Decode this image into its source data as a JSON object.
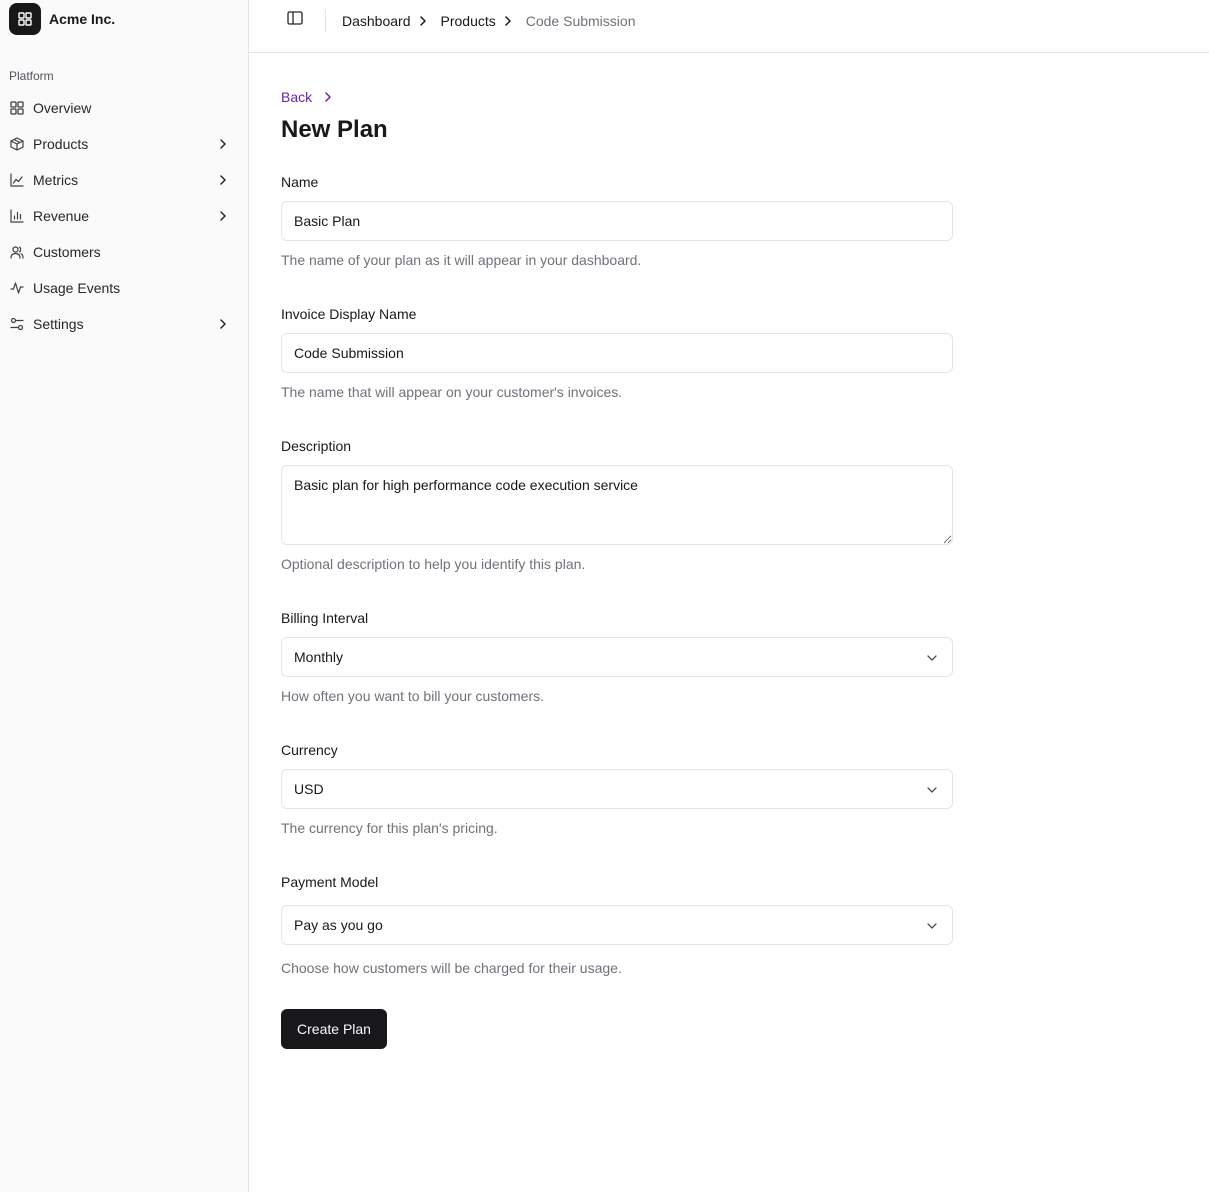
{
  "sidebar": {
    "brand": {
      "name": "Acme Inc.",
      "icon": "grid-icon"
    },
    "group_label": "Platform",
    "items": [
      {
        "label": "Overview",
        "icon": "layout-grid-icon",
        "has_submenu": false
      },
      {
        "label": "Products",
        "icon": "package-icon",
        "has_submenu": true
      },
      {
        "label": "Metrics",
        "icon": "line-chart-icon",
        "has_submenu": true
      },
      {
        "label": "Revenue",
        "icon": "bar-chart-icon",
        "has_submenu": true
      },
      {
        "label": "Customers",
        "icon": "users-icon",
        "has_submenu": false
      },
      {
        "label": "Usage Events",
        "icon": "activity-icon",
        "has_submenu": false
      },
      {
        "label": "Settings",
        "icon": "sliders-icon",
        "has_submenu": true
      }
    ]
  },
  "header": {
    "toggle_icon": "panel-left-icon",
    "breadcrumbs": [
      "Dashboard",
      "Products"
    ],
    "current": "Code Submission"
  },
  "form": {
    "back_label": "Back",
    "title": "New Plan",
    "name": {
      "label": "Name",
      "value": "Basic Plan",
      "help": "The name of your plan as it will appear in your dashboard."
    },
    "invoice_name": {
      "label": "Invoice Display Name",
      "value": "Code Submission",
      "help": "The name that will appear on your customer's invoices."
    },
    "description": {
      "label": "Description",
      "value": "Basic plan for high performance code execution service",
      "help": "Optional description to help you identify this plan."
    },
    "billing_interval": {
      "label": "Billing Interval",
      "value": "Monthly",
      "help": "How often you want to bill your customers."
    },
    "currency": {
      "label": "Currency",
      "value": "USD",
      "help": "The currency for this plan's pricing."
    },
    "payment_model": {
      "label": "Payment Model",
      "value": "Pay as you go",
      "help": "Choose how customers will be charged for their usage."
    },
    "submit_label": "Create Plan"
  },
  "colors": {
    "accent_link": "#6b21a8",
    "primary_button": "#18181b",
    "border": "#e4e4e7",
    "sidebar_bg": "#fafafa"
  }
}
